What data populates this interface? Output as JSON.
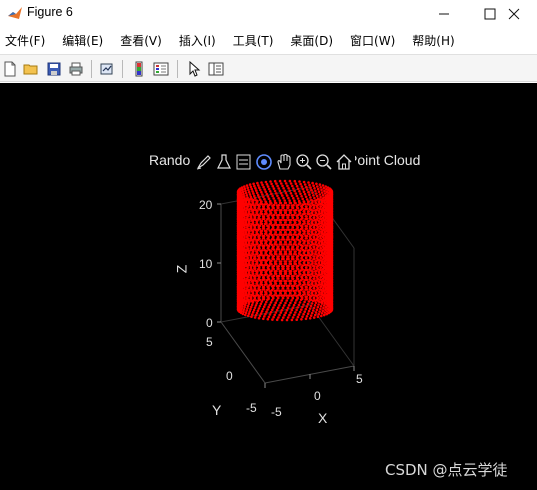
{
  "window": {
    "title": "Figure 6",
    "minimize_glyph": "—",
    "maximize_glyph": "☐",
    "close_glyph": "✕"
  },
  "menu": [
    {
      "label": "文件(F)"
    },
    {
      "label": "编辑(E)"
    },
    {
      "label": "查看(V)"
    },
    {
      "label": "插入(I)"
    },
    {
      "label": "工具(T)"
    },
    {
      "label": "桌面(D)"
    },
    {
      "label": "窗口(W)"
    },
    {
      "label": "帮助(H)"
    }
  ],
  "toolbar": {
    "icons": [
      "new-figure-icon",
      "open-file-icon",
      "save-icon",
      "print-icon",
      "link-plot-icon",
      "insert-colorbar-icon",
      "insert-legend-icon",
      "edit-plot-arrow-icon",
      "property-inspector-icon"
    ]
  },
  "plot": {
    "title_left": "Rando",
    "title_right": "Point Cloud",
    "axes_toolbar_icons": [
      "brush-icon",
      "data-tips-icon",
      "legend-toggle-icon",
      "rotate-3d-icon",
      "pan-icon",
      "zoom-in-icon",
      "zoom-out-icon",
      "home-icon"
    ],
    "z_ticks": [
      "20",
      "10",
      "0"
    ],
    "y_ticks": [
      "5",
      "0",
      "-5"
    ],
    "x_ticks": [
      "-5",
      "0",
      "5"
    ],
    "xlabel": "X",
    "ylabel": "Y",
    "zlabel": "Z",
    "point_color": "#ff0000",
    "background": "#000000"
  },
  "watermark": "CSDN @点云学徒"
}
